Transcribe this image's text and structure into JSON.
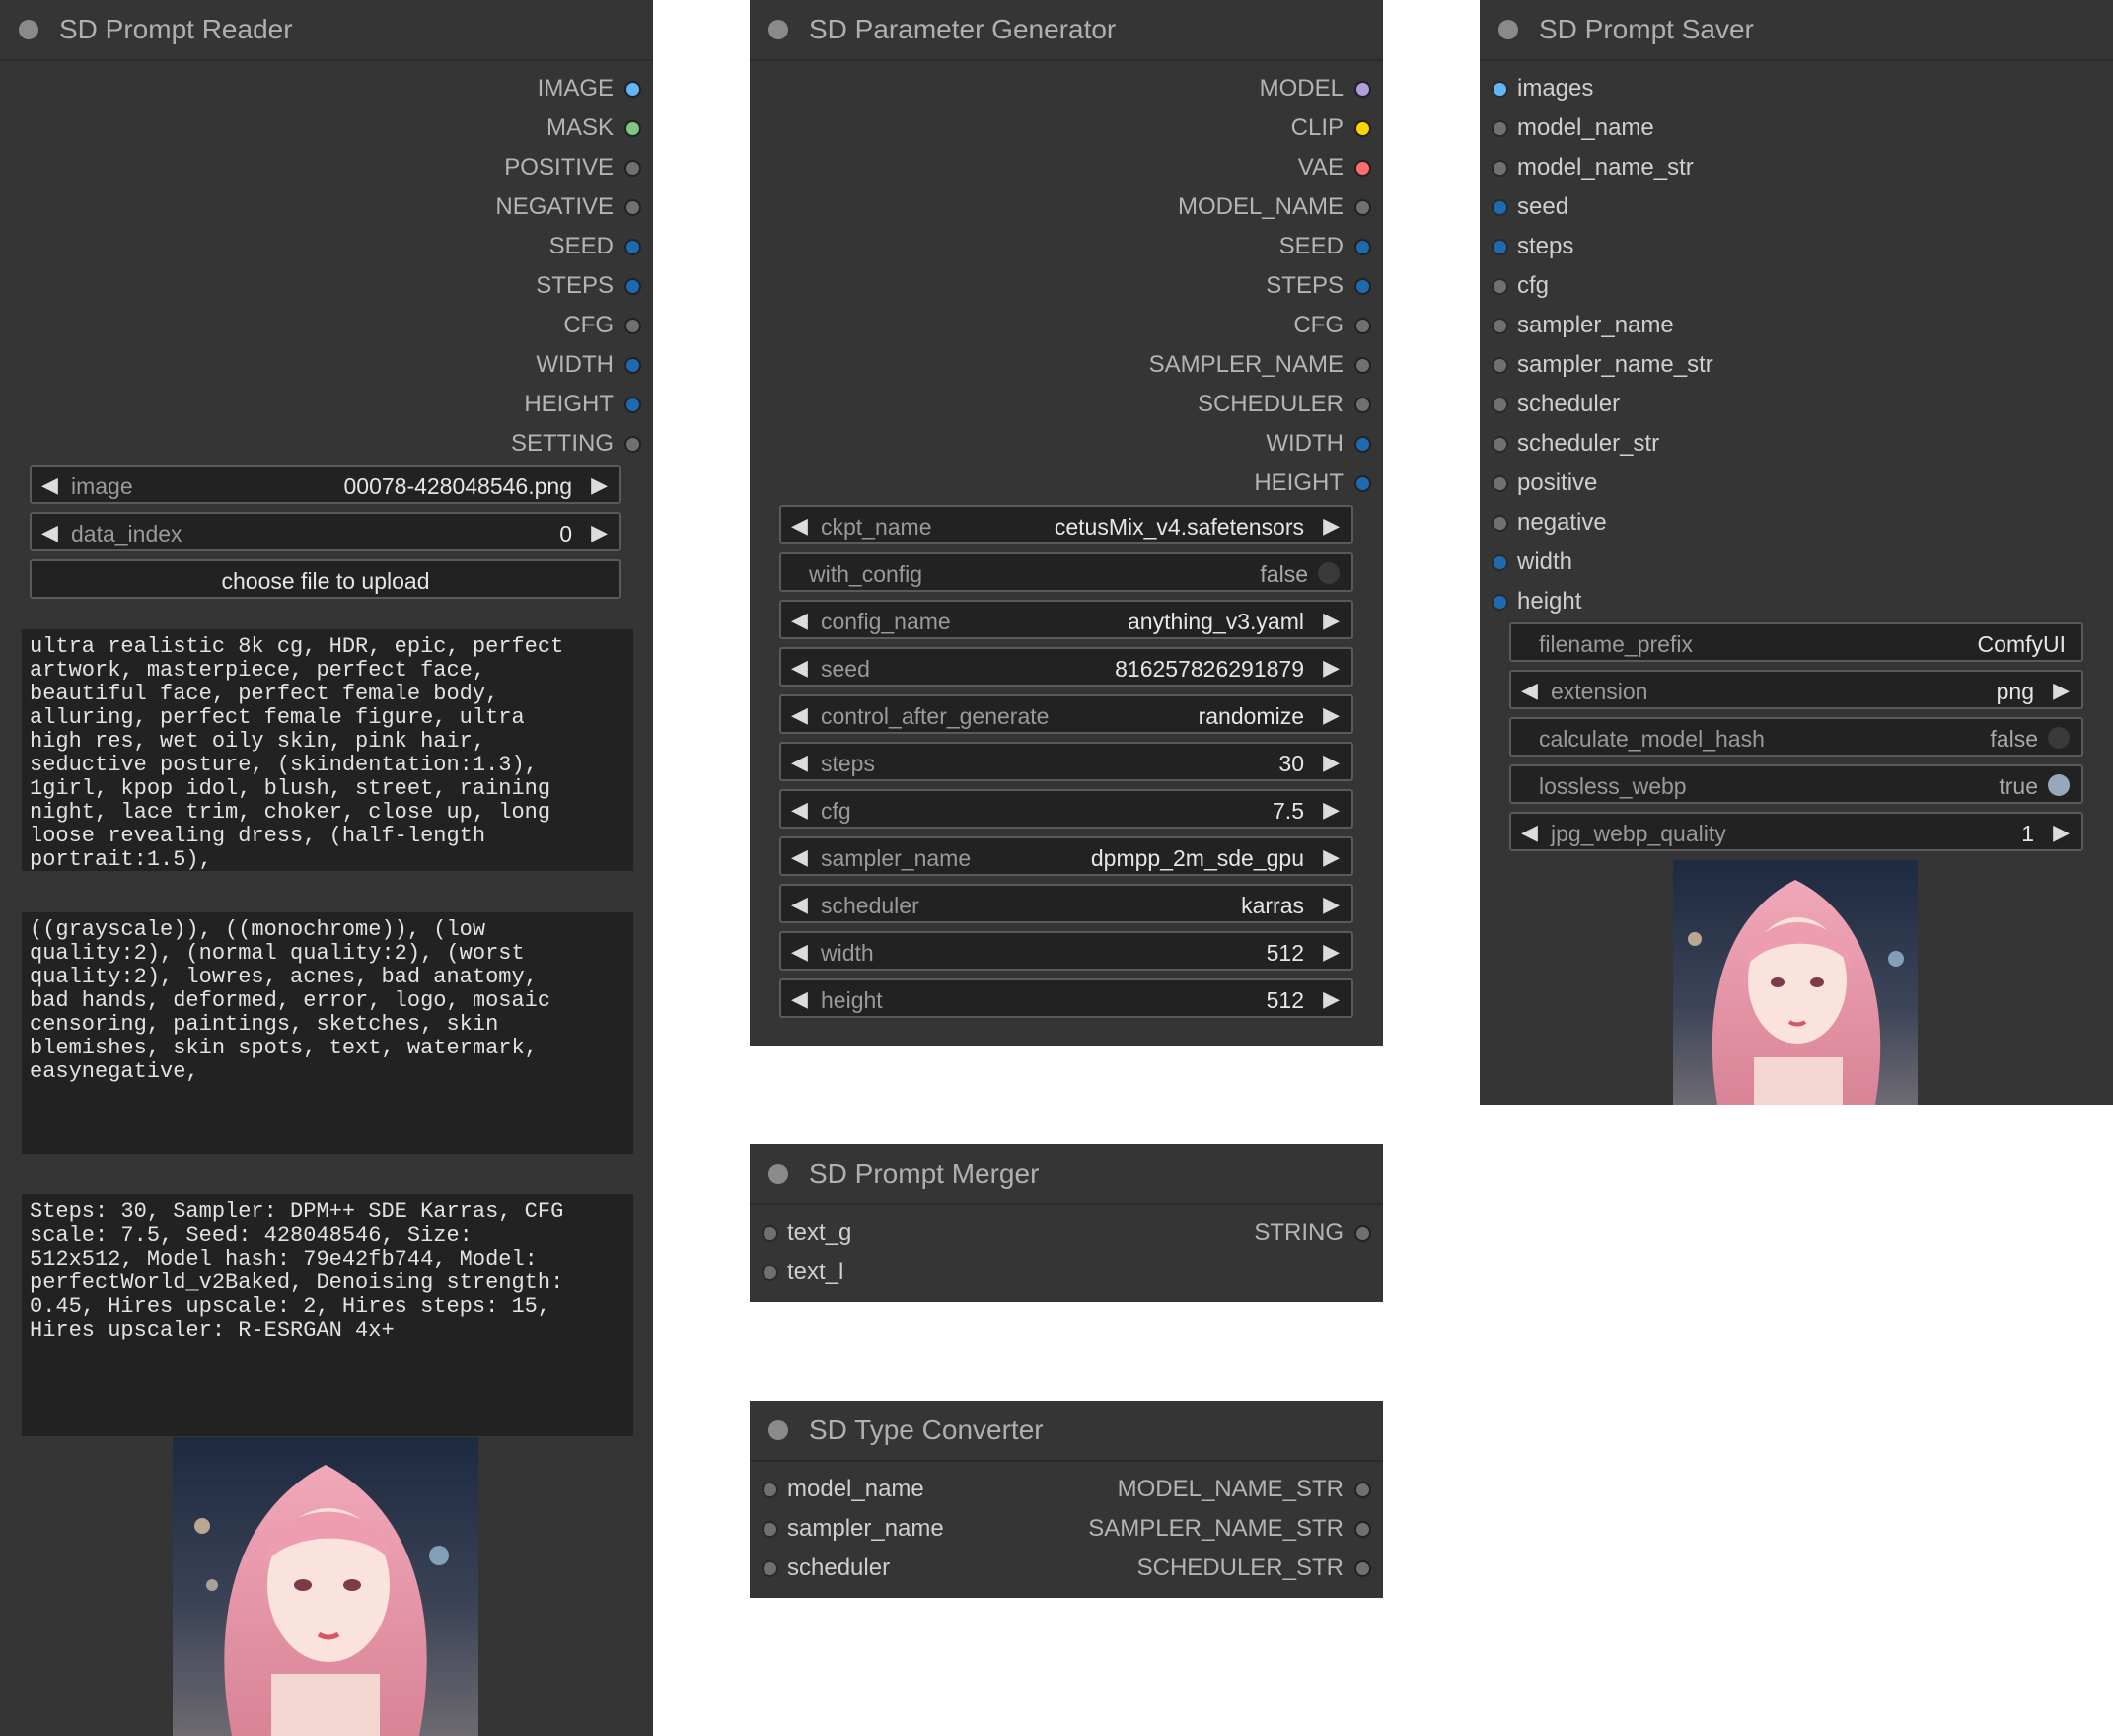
{
  "prompt_reader": {
    "title": "SD Prompt Reader",
    "outputs": [
      {
        "label": "IMAGE",
        "color": "#64b5f6"
      },
      {
        "label": "MASK",
        "color": "#81c784"
      },
      {
        "label": "POSITIVE",
        "color": "#707070"
      },
      {
        "label": "NEGATIVE",
        "color": "#707070"
      },
      {
        "label": "SEED",
        "color": "#1e6ab0"
      },
      {
        "label": "STEPS",
        "color": "#1e6ab0"
      },
      {
        "label": "CFG",
        "color": "#707070"
      },
      {
        "label": "WIDTH",
        "color": "#1e6ab0"
      },
      {
        "label": "HEIGHT",
        "color": "#1e6ab0"
      },
      {
        "label": "SETTING",
        "color": "#707070"
      }
    ],
    "image_widget": {
      "label": "image",
      "value": "00078-428048546.png"
    },
    "data_index_widget": {
      "label": "data_index",
      "value": "0"
    },
    "upload_button": "choose file to upload",
    "positive_text": "ultra realistic 8k cg, HDR, epic, perfect\nartwork, masterpiece, perfect face,\nbeautiful face, perfect female body,\nalluring, perfect female figure, ultra\nhigh res, wet oily skin, pink hair,\nseductive posture, (skindentation:1.3),\n1girl, kpop idol, blush, street, raining\nnight, lace trim, choker, close up, long\nloose revealing dress, (half-length\nportrait:1.5),",
    "negative_text": "((grayscale)), ((monochrome)), (low\nquality:2), (normal quality:2), (worst\nquality:2), lowres, acnes, bad anatomy,\nbad hands, deformed, error, logo, mosaic\ncensoring, paintings, sketches, skin\nblemishes, skin spots, text, watermark,\neasynegative,",
    "settings_text": "Steps: 30, Sampler: DPM++ SDE Karras, CFG\nscale: 7.5, Seed: 428048546, Size:\n512x512, Model hash: 79e42fb744, Model:\nperfectWorld_v2Baked, Denoising strength:\n0.45, Hires upscale: 2, Hires steps: 15,\nHires upscaler: R-ESRGAN 4x+"
  },
  "param_generator": {
    "title": "SD Parameter Generator",
    "outputs": [
      {
        "label": "MODEL",
        "color": "#b39ddb"
      },
      {
        "label": "CLIP",
        "color": "#ffd500"
      },
      {
        "label": "VAE",
        "color": "#ff6e6e"
      },
      {
        "label": "MODEL_NAME",
        "color": "#707070"
      },
      {
        "label": "SEED",
        "color": "#1e6ab0"
      },
      {
        "label": "STEPS",
        "color": "#1e6ab0"
      },
      {
        "label": "CFG",
        "color": "#707070"
      },
      {
        "label": "SAMPLER_NAME",
        "color": "#707070"
      },
      {
        "label": "SCHEDULER",
        "color": "#707070"
      },
      {
        "label": "WIDTH",
        "color": "#1e6ab0"
      },
      {
        "label": "HEIGHT",
        "color": "#1e6ab0"
      }
    ],
    "widgets": [
      {
        "label": "ckpt_name",
        "value": "cetusMix_v4.safetensors"
      },
      {
        "label": "with_config",
        "value": "false",
        "toggle": true,
        "on": false
      },
      {
        "label": "config_name",
        "value": "anything_v3.yaml"
      },
      {
        "label": "seed",
        "value": "816257826291879"
      },
      {
        "label": "control_after_generate",
        "value": "randomize"
      },
      {
        "label": "steps",
        "value": "30"
      },
      {
        "label": "cfg",
        "value": "7.5"
      },
      {
        "label": "sampler_name",
        "value": "dpmpp_2m_sde_gpu"
      },
      {
        "label": "scheduler",
        "value": "karras"
      },
      {
        "label": "width",
        "value": "512"
      },
      {
        "label": "height",
        "value": "512"
      }
    ]
  },
  "prompt_merger": {
    "title": "SD Prompt Merger",
    "inputs": [
      {
        "label": "text_g",
        "color": "#707070"
      },
      {
        "label": "text_l",
        "color": "#707070"
      }
    ],
    "outputs": [
      {
        "label": "STRING",
        "color": "#707070"
      }
    ]
  },
  "type_converter": {
    "title": "SD Type Converter",
    "inputs": [
      {
        "label": "model_name",
        "color": "#707070"
      },
      {
        "label": "sampler_name",
        "color": "#707070"
      },
      {
        "label": "scheduler",
        "color": "#707070"
      }
    ],
    "outputs": [
      {
        "label": "MODEL_NAME_STR",
        "color": "#707070"
      },
      {
        "label": "SAMPLER_NAME_STR",
        "color": "#707070"
      },
      {
        "label": "SCHEDULER_STR",
        "color": "#707070"
      }
    ]
  },
  "prompt_saver": {
    "title": "SD Prompt Saver",
    "inputs": [
      {
        "label": "images",
        "color": "#64b5f6"
      },
      {
        "label": "model_name",
        "color": "#707070"
      },
      {
        "label": "model_name_str",
        "color": "#707070"
      },
      {
        "label": "seed",
        "color": "#1e6ab0"
      },
      {
        "label": "steps",
        "color": "#1e6ab0"
      },
      {
        "label": "cfg",
        "color": "#707070"
      },
      {
        "label": "sampler_name",
        "color": "#707070"
      },
      {
        "label": "sampler_name_str",
        "color": "#707070"
      },
      {
        "label": "scheduler",
        "color": "#707070"
      },
      {
        "label": "scheduler_str",
        "color": "#707070"
      },
      {
        "label": "positive",
        "color": "#707070"
      },
      {
        "label": "negative",
        "color": "#707070"
      },
      {
        "label": "width",
        "color": "#1e6ab0"
      },
      {
        "label": "height",
        "color": "#1e6ab0"
      }
    ],
    "widgets": [
      {
        "label": "filename_prefix",
        "value": "ComfyUI",
        "text": true
      },
      {
        "label": "extension",
        "value": "png"
      },
      {
        "label": "calculate_model_hash",
        "value": "false",
        "toggle": true,
        "on": false
      },
      {
        "label": "lossless_webp",
        "value": "true",
        "toggle": true,
        "on": true
      },
      {
        "label": "jpg_webp_quality",
        "value": "1"
      }
    ]
  }
}
